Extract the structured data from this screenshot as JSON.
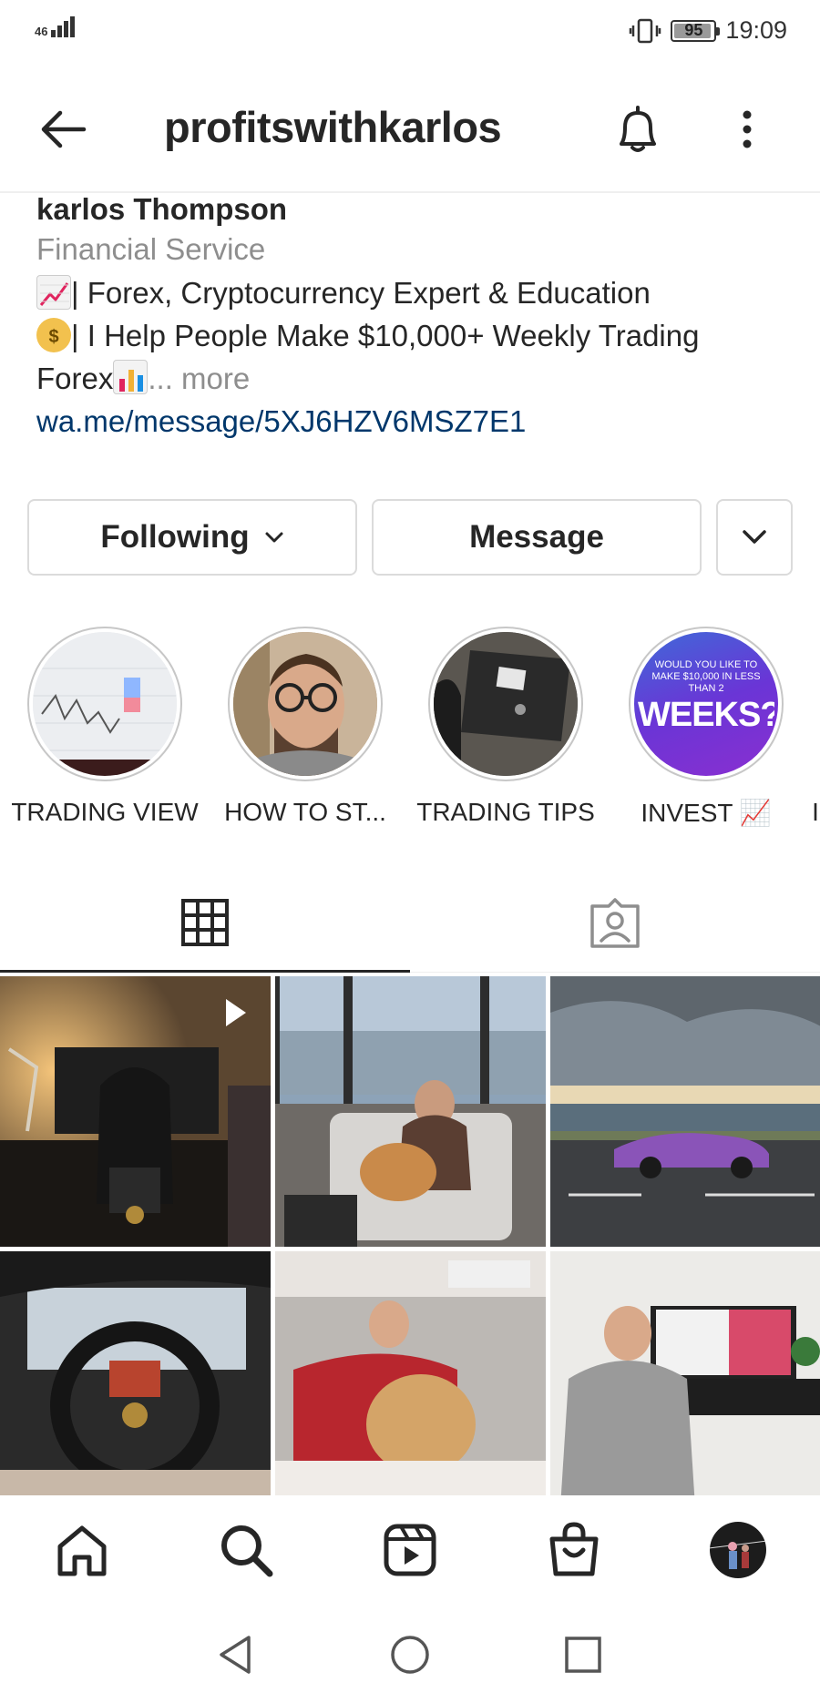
{
  "status_bar": {
    "network": "46",
    "battery": "95",
    "battery_level": 0.95,
    "time": "19:09"
  },
  "header": {
    "username": "profitswithkarlos",
    "back_icon": "arrow-left-icon",
    "bell_icon": "bell-icon",
    "more_icon": "more-vertical-icon"
  },
  "bio": {
    "name": "karlos Thompson",
    "category": "Financial Service",
    "line1": "| Forex, Cryptocurrency Expert & Education",
    "line2": "| I Help People Make $10,000+ Weekly Trading",
    "line3": "Forex",
    "more": "... more",
    "link": "wa.me/message/5XJ6HZV6MSZ7E1"
  },
  "buttons": {
    "following": "Following",
    "message": "Message"
  },
  "highlights": [
    {
      "label": "TRADING VIEW"
    },
    {
      "label": "HOW TO ST..."
    },
    {
      "label": "TRADING TIPS"
    },
    {
      "label": "INVEST 📈"
    },
    {
      "label": "I"
    }
  ],
  "highlight_overlay_text": {
    "small": "WOULD YOU LIKE TO MAKE $10,000 IN LESS THAN 2",
    "big": "WEEKS?"
  },
  "tabs": {
    "grid_icon": "grid-icon",
    "tagged_icon": "tagged-person-icon"
  },
  "bottom_nav": [
    {
      "icon": "home-icon"
    },
    {
      "icon": "search-icon"
    },
    {
      "icon": "reels-icon"
    },
    {
      "icon": "shop-bag-icon"
    },
    {
      "icon": "profile-avatar"
    }
  ],
  "system_nav": [
    {
      "icon": "back-triangle-icon"
    },
    {
      "icon": "home-circle-icon"
    },
    {
      "icon": "recents-square-icon"
    }
  ],
  "colors": {
    "text": "#262626",
    "muted": "#8e8e8e",
    "link": "#00376b",
    "border": "#dbdbdb",
    "highlight_purple": "#5b3fd6"
  }
}
